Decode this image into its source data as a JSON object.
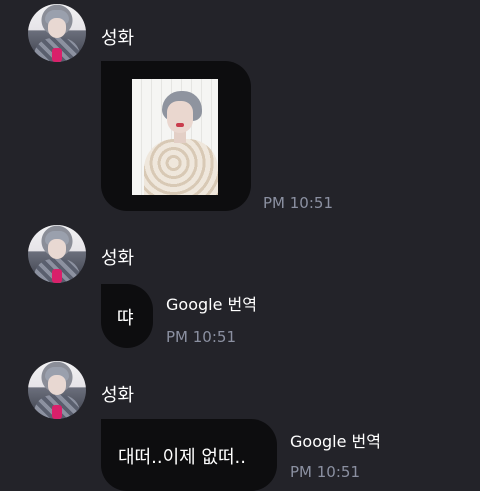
{
  "messages": [
    {
      "sender": "성화",
      "type": "image",
      "time": "PM 10:51"
    },
    {
      "sender": "성화",
      "type": "text",
      "text": "땨",
      "translate_label": "Google 번역",
      "time": "PM 10:51"
    },
    {
      "sender": "성화",
      "type": "text",
      "text": "대떠..이제 없떠..",
      "translate_label": "Google 번역",
      "time": "PM 10:51"
    }
  ],
  "colors": {
    "background": "#232329",
    "bubble": "#0d0d0f",
    "timestamp": "#8b90a1"
  },
  "icons": {
    "avatar": "profile-photo",
    "photo": "portrait-photo"
  }
}
